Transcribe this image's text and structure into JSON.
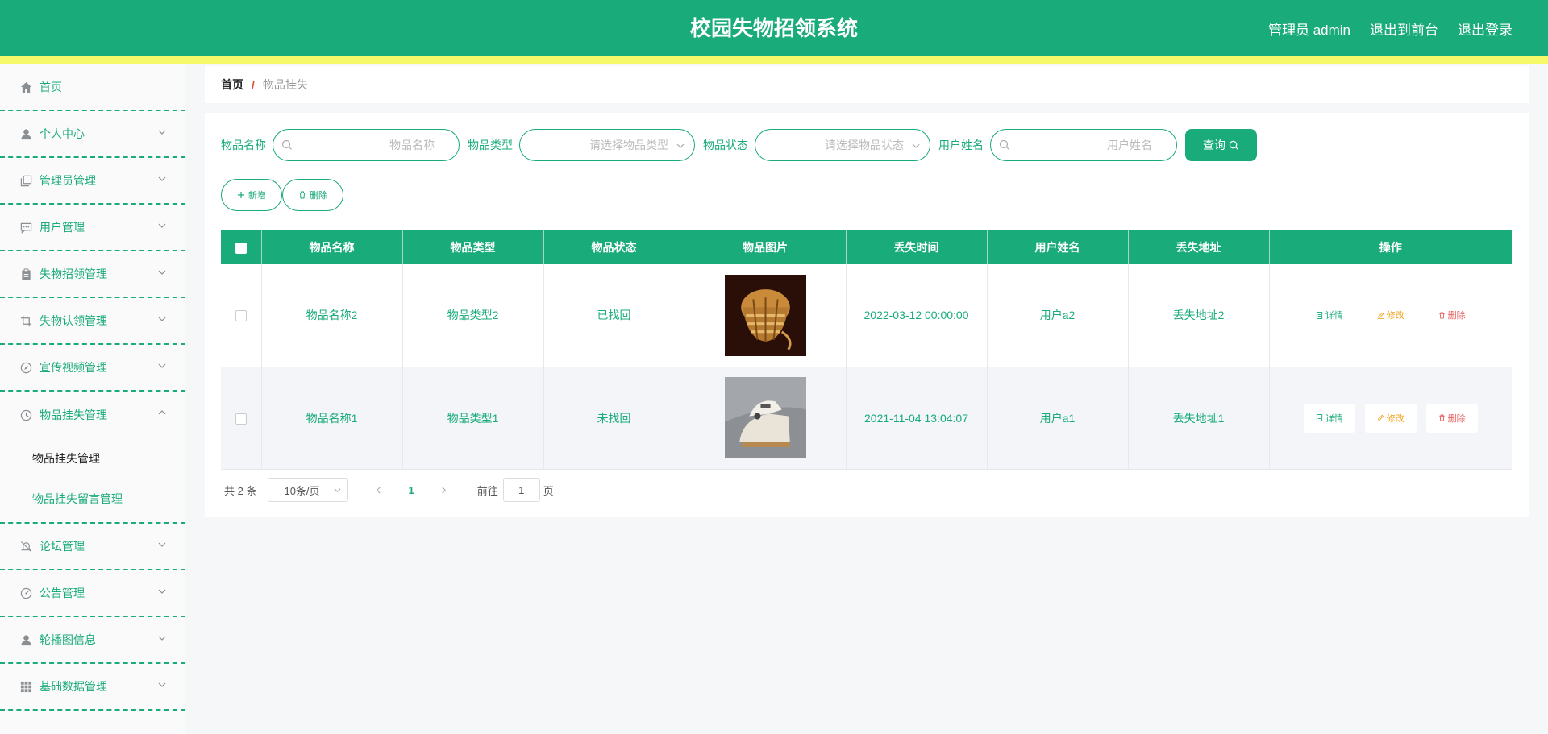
{
  "header": {
    "title": "校园失物招领系统",
    "user_label": "管理员 admin",
    "to_front": "退出到前台",
    "logout": "退出登录"
  },
  "sidebar": {
    "items": [
      {
        "label": "首页",
        "icon": "home-icon"
      },
      {
        "label": "个人中心",
        "icon": "user-icon"
      },
      {
        "label": "管理员管理",
        "icon": "copy-icon"
      },
      {
        "label": "用户管理",
        "icon": "chat-icon"
      },
      {
        "label": "失物招领管理",
        "icon": "clipboard-icon"
      },
      {
        "label": "失物认领管理",
        "icon": "crop-icon"
      },
      {
        "label": "宣传视频管理",
        "icon": "compass-icon"
      },
      {
        "label": "物品挂失管理",
        "icon": "clock-icon"
      },
      {
        "label": "论坛管理",
        "icon": "bell-off-icon"
      },
      {
        "label": "公告管理",
        "icon": "gauge-icon"
      },
      {
        "label": "轮播图信息",
        "icon": "user-icon"
      },
      {
        "label": "基础数据管理",
        "icon": "grid-icon"
      }
    ],
    "submenu": [
      {
        "label": "物品挂失管理"
      },
      {
        "label": "物品挂失留言管理"
      }
    ]
  },
  "breadcrumb": {
    "home": "首页",
    "sep": "/",
    "current": "物品挂失"
  },
  "search": {
    "name_label": "物品名称",
    "name_placeholder": "物品名称",
    "type_label": "物品类型",
    "type_placeholder": "请选择物品类型",
    "status_label": "物品状态",
    "status_placeholder": "请选择物品状态",
    "user_label": "用户姓名",
    "user_placeholder": "用户姓名",
    "query_label": "查询"
  },
  "actions": {
    "add_label": "新增",
    "delete_label": "删除"
  },
  "table": {
    "columns": [
      "物品名称",
      "物品类型",
      "物品状态",
      "物品图片",
      "丢失时间",
      "用户姓名",
      "丢失地址",
      "操作"
    ],
    "rows": [
      {
        "name": "物品名称2",
        "type": "物品类型2",
        "status": "已找回",
        "image": "woven-basket-photo",
        "time": "2022-03-12 00:00:00",
        "user": "用户a2",
        "address": "丢失地址2"
      },
      {
        "name": "物品名称1",
        "type": "物品类型1",
        "status": "未找回",
        "image": "clothes-iron-photo",
        "time": "2021-11-04 13:04:07",
        "user": "用户a1",
        "address": "丢失地址1"
      }
    ],
    "op_detail": "详情",
    "op_edit": "修改",
    "op_delete": "删除"
  },
  "pager": {
    "total": "共 2 条",
    "page_size": "10条/页",
    "current_page": "1",
    "goto_label": "前往",
    "goto_value": "1",
    "page_unit": "页"
  },
  "colors": {
    "primary": "#1aab7a",
    "stripe": "#f5f96a",
    "edit": "#f2a41c",
    "delete": "#e55a5a"
  }
}
